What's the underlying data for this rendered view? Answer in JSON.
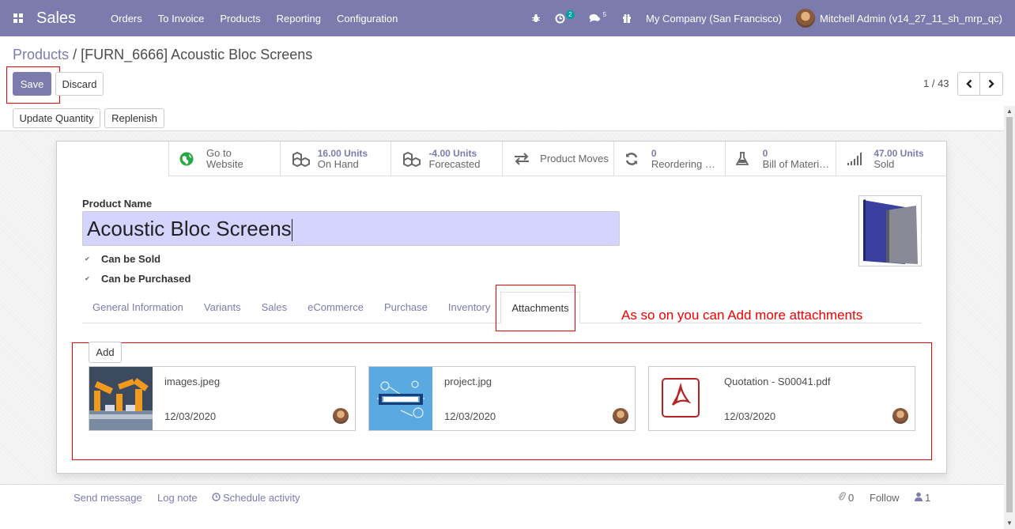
{
  "navbar": {
    "app_name": "Sales",
    "menu": [
      "Orders",
      "To Invoice",
      "Products",
      "Reporting",
      "Configuration"
    ],
    "activity_count": "2",
    "message_count": "5",
    "company": "My Company (San Francisco)",
    "user": "Mitchell Admin (v14_27_11_sh_mrp_qc)"
  },
  "breadcrumb": {
    "parent": "Products",
    "separator": "/",
    "current": "[FURN_6666] Acoustic Bloc Screens"
  },
  "buttons": {
    "save": "Save",
    "discard": "Discard",
    "update_quantity": "Update Quantity",
    "replenish": "Replenish",
    "add": "Add"
  },
  "pager": {
    "value": "1 / 43"
  },
  "smart_buttons": [
    {
      "value": "",
      "label_1": "Go to",
      "label_2": "Website"
    },
    {
      "value": "16.00 Units",
      "label": "On Hand"
    },
    {
      "value": "-4.00 Units",
      "label": "Forecasted"
    },
    {
      "label": "Product Moves"
    },
    {
      "value": "0",
      "label": "Reordering Rules"
    },
    {
      "value": "0",
      "label": "Bill of Materials"
    },
    {
      "value": "47.00 Units",
      "label": "Sold"
    }
  ],
  "product": {
    "name_label": "Product Name",
    "name": "Acoustic Bloc Screens",
    "can_be_sold": "Can be Sold",
    "can_be_purchased": "Can be Purchased"
  },
  "tabs": [
    "General Information",
    "Variants",
    "Sales",
    "eCommerce",
    "Purchase",
    "Inventory",
    "Attachments"
  ],
  "active_tab": "Attachments",
  "annotation": "As so on you can Add more attachments",
  "attachments": [
    {
      "name": "images.jpeg",
      "date": "12/03/2020"
    },
    {
      "name": "project.jpg",
      "date": "12/03/2020"
    },
    {
      "name": "Quotation - S00041.pdf",
      "date": "12/03/2020"
    }
  ],
  "chatter": {
    "send_message": "Send message",
    "log_note": "Log note",
    "schedule_activity": "Schedule activity",
    "attachment_count": "0",
    "follow": "Follow",
    "follower_count": "1"
  },
  "colors": {
    "brand": "#7c7bad",
    "highlight": "#e00000",
    "input_focus": "#d4d4ff"
  }
}
